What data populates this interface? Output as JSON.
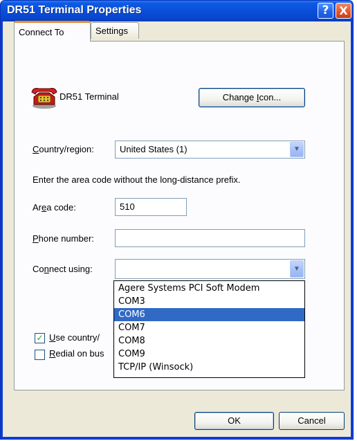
{
  "window": {
    "title": "DR51 Terminal Properties",
    "help_glyph": "?",
    "close_glyph": "X"
  },
  "tabs": [
    {
      "label": "Connect To",
      "active": true
    },
    {
      "label": "Settings",
      "active": false
    }
  ],
  "connection": {
    "name": "DR51 Terminal",
    "change_icon_pre": "Change ",
    "change_icon_u": "I",
    "change_icon_post": "con..."
  },
  "country": {
    "label_u": "C",
    "label_rest": "ountry/region:",
    "value": "United States (1)"
  },
  "area_instruction": "Enter the area code without the long-distance prefix.",
  "area_code": {
    "label_pre": "Ar",
    "label_u": "e",
    "label_post": "a code:",
    "value": "510"
  },
  "phone_number": {
    "label_u": "P",
    "label_rest": "hone number:",
    "value": ""
  },
  "connect_using": {
    "label_pre": "Co",
    "label_u": "n",
    "label_post": "nect using:",
    "value": "",
    "options": [
      "Agere Systems PCI Soft Modem",
      "COM3",
      "COM6",
      "COM7",
      "COM8",
      "COM9",
      "TCP/IP (Winsock)"
    ],
    "highlighted_index": 2
  },
  "checkboxes": {
    "use_country_u": "U",
    "use_country_rest": "se country/",
    "use_country_checked": true,
    "redial_u": "R",
    "redial_rest": "edial on bus",
    "redial_checked": false
  },
  "buttons": {
    "ok": "OK",
    "cancel": "Cancel"
  },
  "colors": {
    "title_bar": "#0a4fd8",
    "selection": "#316ac5",
    "dialog_face": "#ece9d8",
    "tab_accent": "#e68b2c"
  }
}
